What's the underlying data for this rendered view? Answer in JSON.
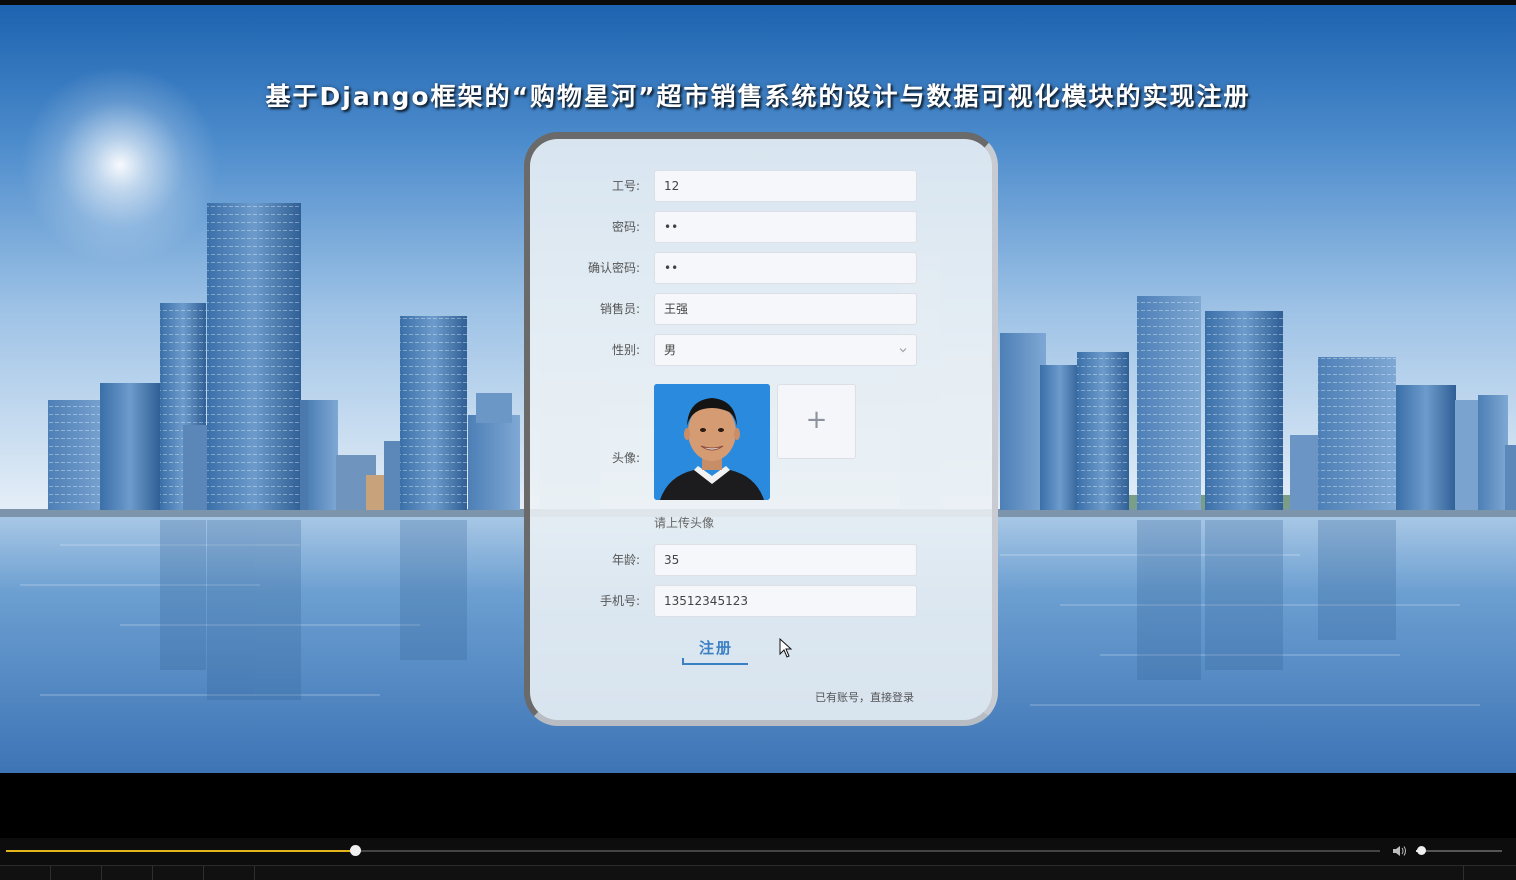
{
  "page": {
    "title": "基于Django框架的“购物星河”超市销售系统的设计与数据可视化模块的实现注册"
  },
  "form": {
    "fields": [
      {
        "label": "工号:",
        "value": "12"
      },
      {
        "label": "密码:",
        "value": "••"
      },
      {
        "label": "确认密码:",
        "value": "••"
      },
      {
        "label": "销售员:",
        "value": "王强"
      }
    ],
    "gender": {
      "label": "性别:",
      "value": "男"
    },
    "avatar": {
      "label": "头像:",
      "upload_symbol": "+",
      "hint": "请上传头像"
    },
    "fields2": [
      {
        "label": "年龄:",
        "value": "35"
      },
      {
        "label": "手机号:",
        "value": "13512345123"
      }
    ],
    "register_label": "注册",
    "login_link": "已有账号，直接登录"
  },
  "player": {
    "progress": 0.254,
    "volume": 0.06,
    "colors": {
      "progress": "#e3b51b"
    }
  },
  "icons": {
    "select": "chevron-down-icon",
    "upload": "plus-icon",
    "volume": "speaker-icon",
    "cursor": "mouse-cursor-icon"
  }
}
